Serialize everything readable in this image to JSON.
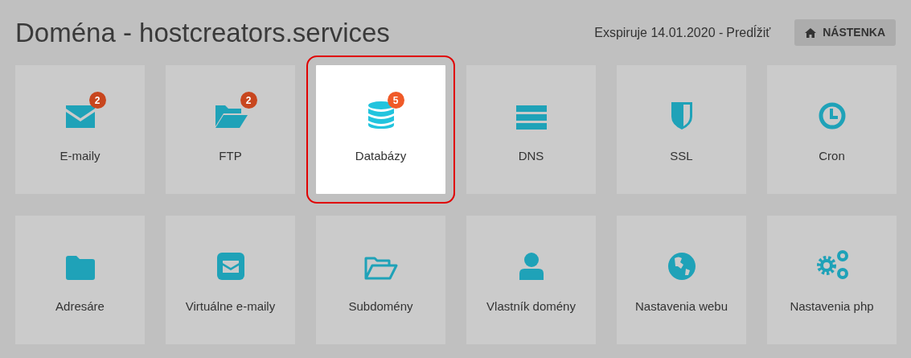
{
  "header": {
    "title": "Doména - hostcreators.services",
    "expiry": "Exspiruje 14.01.2020 -",
    "renew_link": "Predĺžiť",
    "dashboard_button": "NÁSTENKA"
  },
  "tiles": [
    {
      "label": "E-maily",
      "badge": "2",
      "selected": false
    },
    {
      "label": "FTP",
      "badge": "2",
      "selected": false
    },
    {
      "label": "Databázy",
      "badge": "5",
      "selected": true
    },
    {
      "label": "DNS",
      "selected": false
    },
    {
      "label": "SSL",
      "selected": false
    },
    {
      "label": "Cron",
      "selected": false
    },
    {
      "label": "Adresáre",
      "selected": false
    },
    {
      "label": "Virtuálne e-maily",
      "selected": false
    },
    {
      "label": "Subdomény",
      "selected": false
    },
    {
      "label": "Vlastník domény",
      "selected": false
    },
    {
      "label": "Nastavenia webu",
      "selected": false
    },
    {
      "label": "Nastavenia php",
      "selected": false
    }
  ]
}
